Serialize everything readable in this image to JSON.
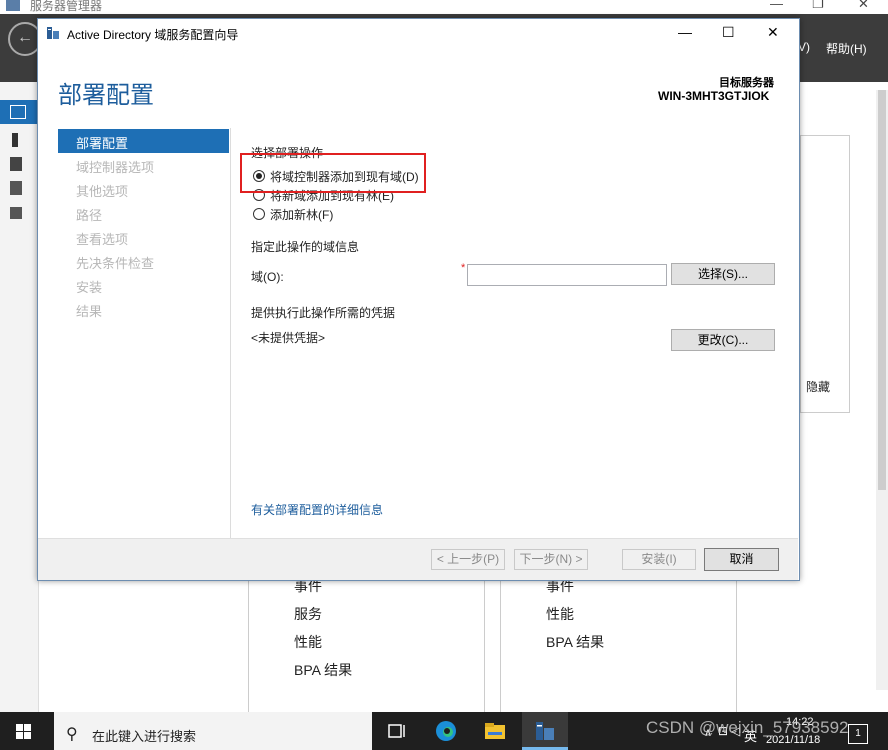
{
  "server_manager": {
    "title": "服务器管理器",
    "menu": [
      "V)",
      "帮助(H)"
    ],
    "hide_label": "隐藏",
    "cards": [
      {
        "items": [
          "事件",
          "服务",
          "性能",
          "BPA 结果"
        ]
      },
      {
        "items": [
          "事件",
          "性能",
          "BPA 结果"
        ]
      }
    ]
  },
  "dialog": {
    "title": "Active Directory 域服务配置向导",
    "heading": "部署配置",
    "target_label": "目标服务器",
    "target_server": "WIN-3MHT3GTJIOK",
    "nav": [
      {
        "label": "部署配置",
        "active": true
      },
      {
        "label": "域控制器选项",
        "active": false
      },
      {
        "label": "其他选项",
        "active": false
      },
      {
        "label": "路径",
        "active": false
      },
      {
        "label": "查看选项",
        "active": false
      },
      {
        "label": "先决条件检查",
        "active": false
      },
      {
        "label": "安装",
        "active": false
      },
      {
        "label": "结果",
        "active": false
      }
    ],
    "select_operation_label": "选择部署操作",
    "radios": [
      {
        "label": "将域控制器添加到现有域(D)",
        "selected": true
      },
      {
        "label": "将新域添加到现有林(E)",
        "selected": false
      },
      {
        "label": "添加新林(F)",
        "selected": false
      }
    ],
    "domain_info_label": "指定此操作的域信息",
    "domain_field_label": "域(O):",
    "domain_value": "",
    "select_button": "选择(S)...",
    "credentials_label": "提供执行此操作所需的凭据",
    "credentials_value": "<未提供凭据>",
    "change_button": "更改(C)...",
    "more_info_link": "有关部署配置的详细信息",
    "footer": {
      "back": "< 上一步(P)",
      "next": "下一步(N) >",
      "install": "安装(I)",
      "cancel": "取消"
    }
  },
  "taskbar": {
    "search_placeholder": "在此键入进行搜索",
    "time": "14:22",
    "date": "2021/11/18",
    "ime": "英",
    "notification_count": "1",
    "icons": [
      "task-view-icon",
      "edge-icon",
      "file-explorer-icon",
      "server-manager-icon"
    ]
  },
  "watermark": "CSDN @weixin_57938592",
  "colors": {
    "accent": "#1e6fb5",
    "heading": "#1d5d9c",
    "highlight_box": "#e02020",
    "taskbar": "#1f1f1f"
  }
}
